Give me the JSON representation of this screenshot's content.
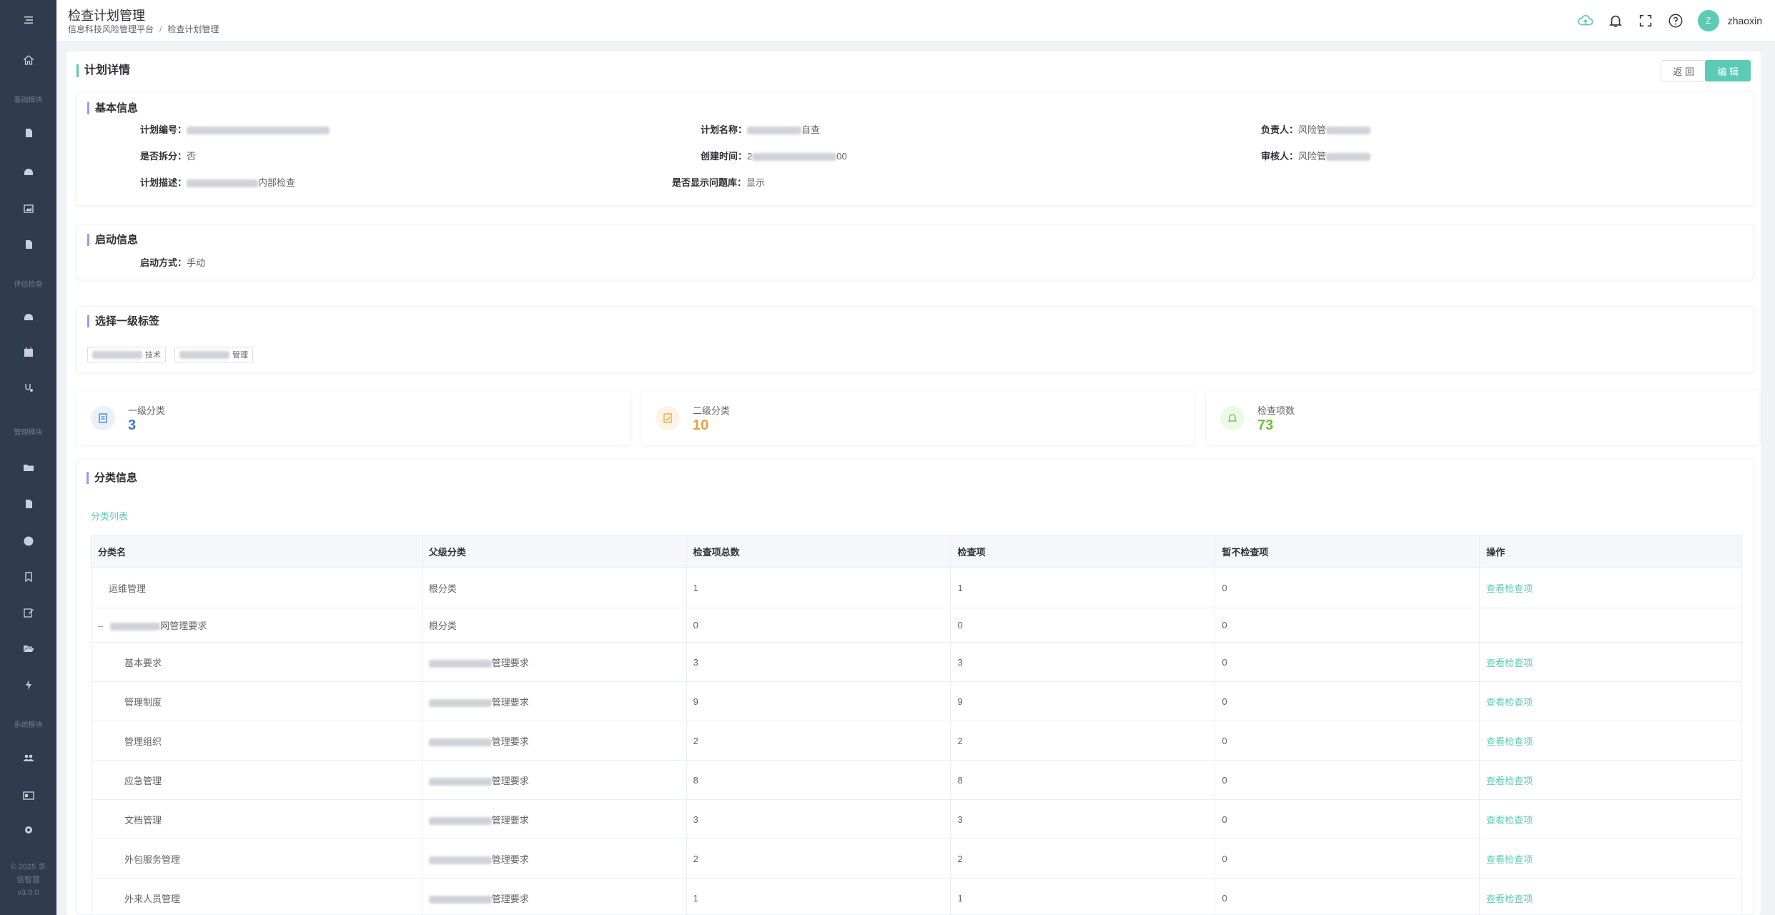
{
  "header": {
    "title": "检查计划管理",
    "breadcrumb": [
      "信息科技风险管理平台",
      "检查计划管理"
    ],
    "username": "zhaoxin",
    "avatar_letter": "Z",
    "accent_color": "#5ccbb5"
  },
  "sidebar": {
    "groups": [
      "基础模块",
      "评估检查",
      "管理模块",
      "系统模块"
    ],
    "footer": [
      "© 2025 华",
      "信智慧",
      "v3.0.0"
    ]
  },
  "page": {
    "title": "计划详情",
    "back_label": "返 回",
    "edit_label": "编 辑"
  },
  "basic_info": {
    "title": "基本信息",
    "plan_no_label": "计划编号：",
    "plan_name_label": "计划名称：",
    "plan_name_value": "自查",
    "owner_label": "负责人：",
    "owner_value": "风险管",
    "split_label": "是否拆分：",
    "split_value": "否",
    "created_label": "创建时间：",
    "created_prefix": "2",
    "created_suffix": "00",
    "reviewer_label": "审核人：",
    "reviewer_value": "风险管",
    "desc_label": "计划描述：",
    "desc_value": "内部检查",
    "show_qb_label": "是否显示问题库：",
    "show_qb_value": "显示"
  },
  "launch_info": {
    "title": "启动信息",
    "mode_label": "启动方式：",
    "mode_value": "手动"
  },
  "tags_section": {
    "title": "选择一级标签",
    "tags": [
      "技术",
      "管理"
    ]
  },
  "stats": [
    {
      "label": "一级分类",
      "value": "3",
      "color": "#3a7bd5"
    },
    {
      "label": "二级分类",
      "value": "10",
      "color": "#e6a23c"
    },
    {
      "label": "检查项数",
      "value": "73",
      "color": "#67c23a"
    }
  ],
  "category": {
    "title": "分类信息",
    "list_link": "分类列表",
    "columns": [
      "分类名",
      "父级分类",
      "检查项总数",
      "检查项",
      "暂不检查项",
      "操作"
    ],
    "rows": [
      {
        "name": "运维管理",
        "parent": "根分类",
        "total": "1",
        "items": "1",
        "skip": "0",
        "action": "查看检查项"
      },
      {
        "name": "网管理要求",
        "parent": "根分类",
        "total": "0",
        "items": "0",
        "skip": "0",
        "action": ""
      },
      {
        "name": "基本要求",
        "parent": "管理要求",
        "total": "3",
        "items": "3",
        "skip": "0",
        "action": "查看检查项"
      },
      {
        "name": "管理制度",
        "parent": "管理要求",
        "total": "9",
        "items": "9",
        "skip": "0",
        "action": "查看检查项"
      },
      {
        "name": "管理组织",
        "parent": "管理要求",
        "total": "2",
        "items": "2",
        "skip": "0",
        "action": "查看检查项"
      },
      {
        "name": "应急管理",
        "parent": "管理要求",
        "total": "8",
        "items": "8",
        "skip": "0",
        "action": "查看检查项"
      },
      {
        "name": "文档管理",
        "parent": "管理要求",
        "total": "3",
        "items": "3",
        "skip": "0",
        "action": "查看检查项"
      },
      {
        "name": "外包服务管理",
        "parent": "管理要求",
        "total": "2",
        "items": "2",
        "skip": "0",
        "action": "查看检查项"
      },
      {
        "name": "外来人员管理",
        "parent": "管理要求",
        "total": "1",
        "items": "1",
        "skip": "0",
        "action": "查看检查项"
      }
    ]
  }
}
